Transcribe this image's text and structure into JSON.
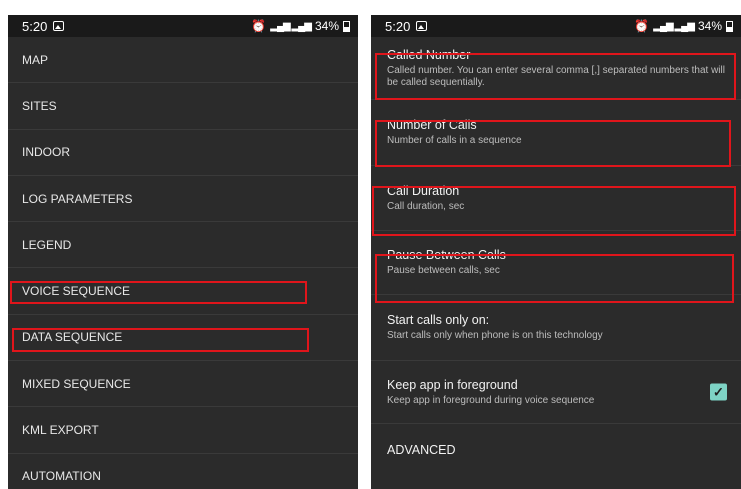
{
  "left_screen": {
    "status": {
      "time": "5:20",
      "battery": "34%"
    },
    "menu_items": [
      "MAP",
      "SITES",
      "INDOOR",
      "LOG PARAMETERS",
      "LEGEND",
      "VOICE SEQUENCE",
      "DATA SEQUENCE",
      "MIXED SEQUENCE",
      "KML EXPORT",
      "AUTOMATION"
    ]
  },
  "right_screen": {
    "status": {
      "time": "5:20",
      "battery": "34%"
    },
    "settings": [
      {
        "title": "Called Number",
        "summary": "Called number. You can enter several comma [,] separated numbers that will be called sequentially."
      },
      {
        "title": "Number of Calls",
        "summary": "Number of calls in a sequence"
      },
      {
        "title": "Call Duration",
        "summary": "Call duration, sec"
      },
      {
        "title": "Pause Between Calls",
        "summary": "Pause between calls, sec"
      },
      {
        "title": "Start calls only on:",
        "summary": "Start calls only when phone is on this technology"
      },
      {
        "title": "Keep app in foreground",
        "summary": "Keep app in foreground during voice sequence",
        "checked": true
      },
      {
        "title": "ADVANCED",
        "summary": ""
      }
    ]
  },
  "colors": {
    "highlight": "#e0151b",
    "checkbox": "#7ed3c5",
    "background": "#2b2b2b"
  },
  "icons": [
    "image-icon",
    "alarm-icon",
    "signal-icon",
    "battery-icon",
    "check-icon"
  ]
}
